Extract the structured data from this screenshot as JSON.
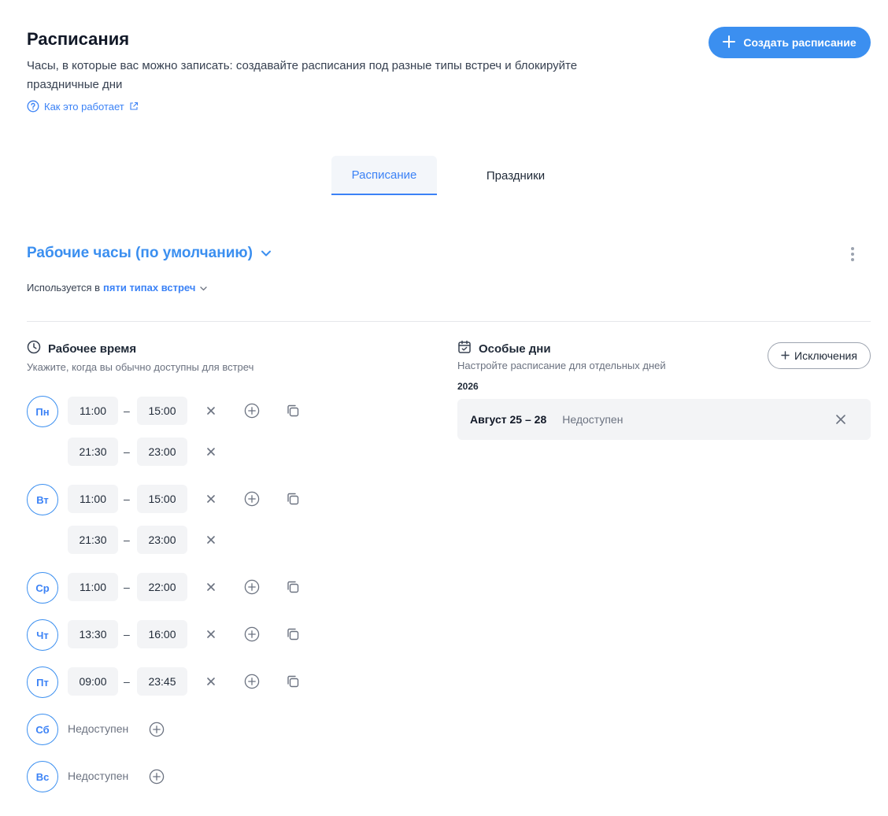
{
  "header": {
    "title": "Расписания",
    "description": "Часы, в которые вас можно записать: создавайте расписания под разные типы встреч и блокируйте праздничные дни",
    "how_link": "Как это работает",
    "create_button": "Создать расписание"
  },
  "tabs": [
    {
      "label": "Расписание",
      "active": true
    },
    {
      "label": "Праздники",
      "active": false
    }
  ],
  "schedule": {
    "name": "Рабочие часы (по умолчанию)",
    "used_in_prefix": "Используется в",
    "used_in_link": "пяти типах встреч"
  },
  "working_time": {
    "title": "Рабочее время",
    "subtitle": "Укажите, когда вы обычно доступны для встреч",
    "days": [
      {
        "label": "Пн",
        "slots": [
          {
            "from": "11:00",
            "to": "15:00"
          },
          {
            "from": "21:30",
            "to": "23:00"
          }
        ]
      },
      {
        "label": "Вт",
        "slots": [
          {
            "from": "11:00",
            "to": "15:00"
          },
          {
            "from": "21:30",
            "to": "23:00"
          }
        ]
      },
      {
        "label": "Ср",
        "slots": [
          {
            "from": "11:00",
            "to": "22:00"
          }
        ]
      },
      {
        "label": "Чт",
        "slots": [
          {
            "from": "13:30",
            "to": "16:00"
          }
        ]
      },
      {
        "label": "Пт",
        "slots": [
          {
            "from": "09:00",
            "to": "23:45"
          }
        ]
      },
      {
        "label": "Сб",
        "unavailable": "Недоступен"
      },
      {
        "label": "Вс",
        "unavailable": "Недоступен"
      }
    ],
    "dash": "–"
  },
  "special_days": {
    "title": "Особые дни",
    "subtitle": "Настройте расписание для отдельных дней",
    "add_button": "Исключения",
    "year": "2026",
    "items": [
      {
        "dates": "Август 25 – 28",
        "status": "Недоступен"
      }
    ]
  },
  "colors": {
    "accent": "#3b8ff0",
    "muted_text": "#6b7280",
    "field_bg": "#f3f4f6"
  }
}
